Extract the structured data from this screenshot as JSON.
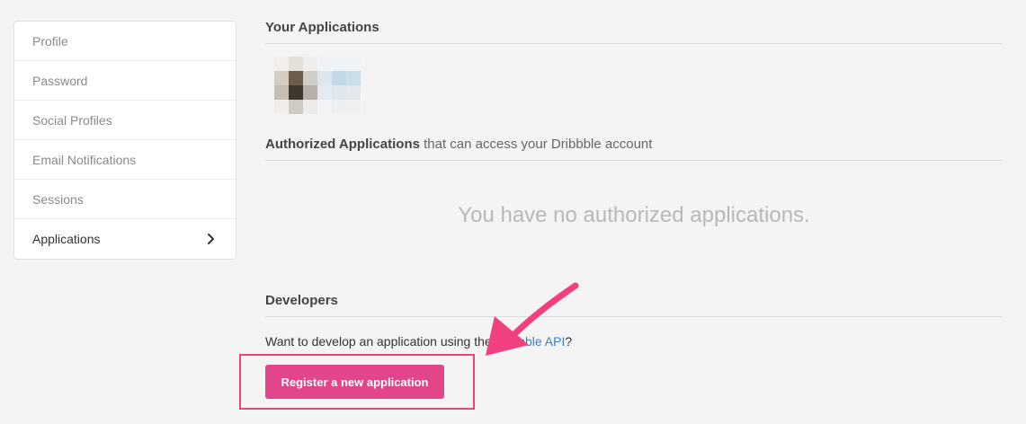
{
  "sidebar": {
    "items": [
      {
        "label": "Profile"
      },
      {
        "label": "Password"
      },
      {
        "label": "Social Profiles"
      },
      {
        "label": "Email Notifications"
      },
      {
        "label": "Sessions"
      },
      {
        "label": "Applications"
      }
    ],
    "active": "Applications"
  },
  "main": {
    "your_apps_title": "Your Applications",
    "authorized_title": "Authorized Applications",
    "authorized_subtitle": " that can access your Dribbble account",
    "empty_message": "You have no authorized applications.",
    "developers_title": "Developers",
    "developers_text_prefix": "Want to develop an application using the ",
    "developers_link": "Dribbble API",
    "developers_text_suffix": "?",
    "register_button": "Register a new application"
  },
  "colors": {
    "accent": "#e2458a",
    "link": "#3a7bbf",
    "annotation": "#f0407f"
  }
}
